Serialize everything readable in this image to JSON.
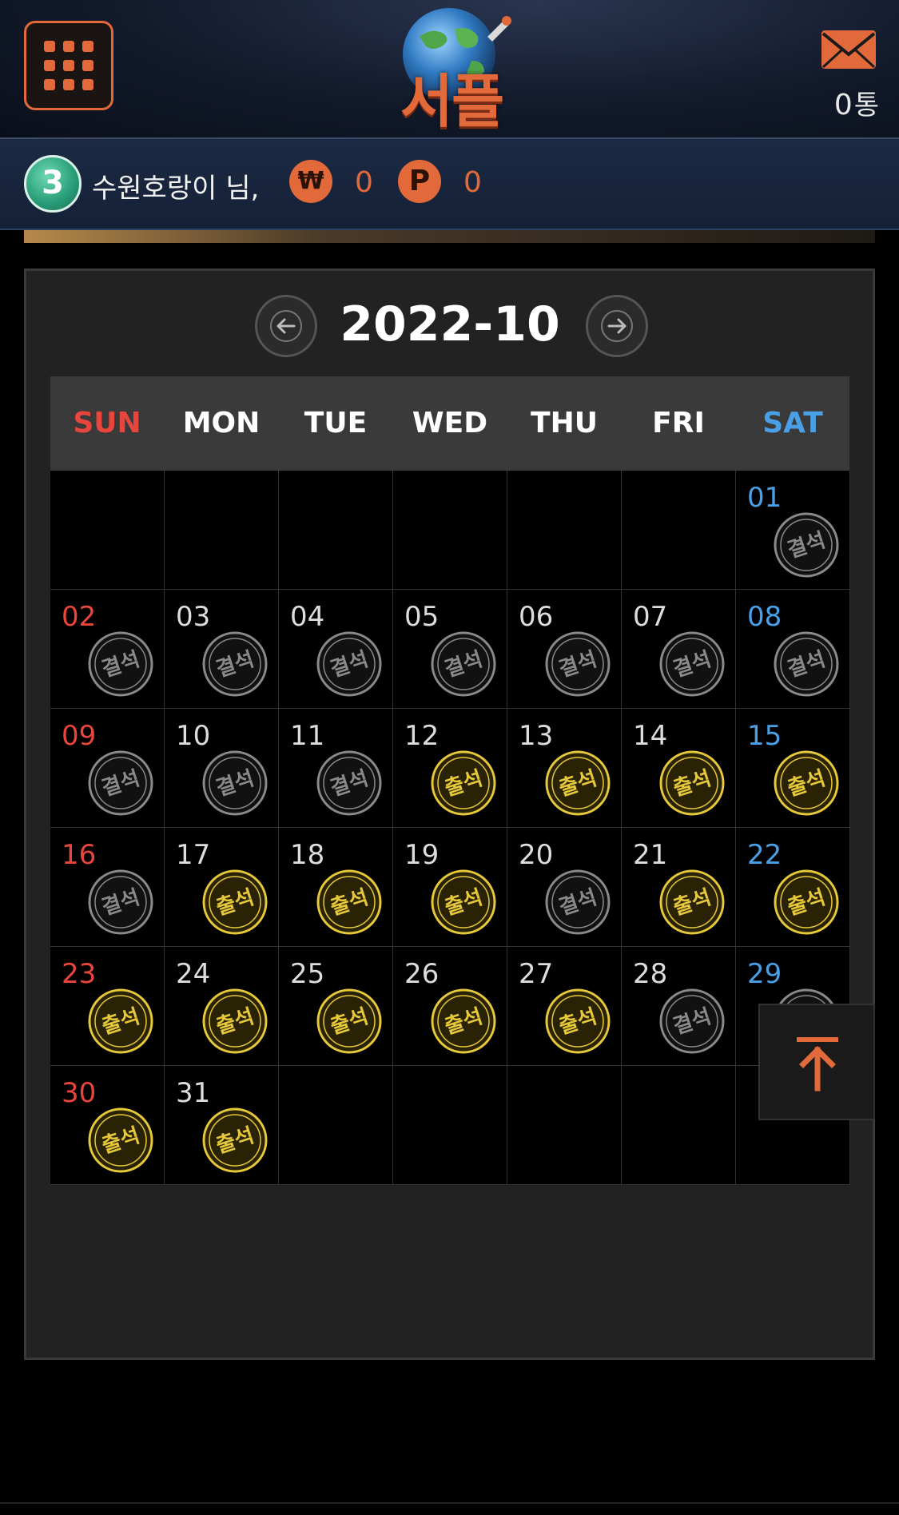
{
  "header": {
    "logo_text": "서플",
    "mail_count": "0",
    "mail_unit": "통"
  },
  "user": {
    "level": "3",
    "name": "수원호랑이 님,",
    "won_icon": "₩",
    "won_value": "0",
    "point_icon": "P",
    "point_value": "0"
  },
  "calendar": {
    "title": "2022-10",
    "weekdays": [
      "SUN",
      "MON",
      "TUE",
      "WED",
      "THU",
      "FRI",
      "SAT"
    ],
    "days": [
      {
        "day": "01",
        "stamp": "결석"
      },
      {
        "day": "02",
        "stamp": "결석"
      },
      {
        "day": "03",
        "stamp": "결석"
      },
      {
        "day": "04",
        "stamp": "결석"
      },
      {
        "day": "05",
        "stamp": "결석"
      },
      {
        "day": "06",
        "stamp": "결석"
      },
      {
        "day": "07",
        "stamp": "결석"
      },
      {
        "day": "08",
        "stamp": "결석"
      },
      {
        "day": "09",
        "stamp": "결석"
      },
      {
        "day": "10",
        "stamp": "결석"
      },
      {
        "day": "11",
        "stamp": "결석"
      },
      {
        "day": "12",
        "stamp": "출석"
      },
      {
        "day": "13",
        "stamp": "출석"
      },
      {
        "day": "14",
        "stamp": "출석"
      },
      {
        "day": "15",
        "stamp": "출석"
      },
      {
        "day": "16",
        "stamp": "결석"
      },
      {
        "day": "17",
        "stamp": "출석"
      },
      {
        "day": "18",
        "stamp": "출석"
      },
      {
        "day": "19",
        "stamp": "출석"
      },
      {
        "day": "20",
        "stamp": "결석"
      },
      {
        "day": "21",
        "stamp": "출석"
      },
      {
        "day": "22",
        "stamp": "출석"
      },
      {
        "day": "23",
        "stamp": "출석"
      },
      {
        "day": "24",
        "stamp": "출석"
      },
      {
        "day": "25",
        "stamp": "출석"
      },
      {
        "day": "26",
        "stamp": "출석"
      },
      {
        "day": "27",
        "stamp": "출석"
      },
      {
        "day": "28",
        "stamp": "결석"
      },
      {
        "day": "29",
        "stamp": "결석"
      },
      {
        "day": "30",
        "stamp": "출석"
      },
      {
        "day": "31",
        "stamp": "출석"
      }
    ],
    "first_weekday": 6
  },
  "colors": {
    "accent": "#e2693a",
    "sunday": "#e8453c",
    "saturday": "#4aa0e6",
    "present_stamp": "#e6c93a",
    "absent_stamp": "#8a8a8a"
  },
  "icons": {
    "menu": "grid-menu-icon",
    "mail": "envelope-icon",
    "prev": "arrow-left-icon",
    "next": "arrow-right-icon",
    "scroll_top": "arrow-up-to-top-icon"
  }
}
